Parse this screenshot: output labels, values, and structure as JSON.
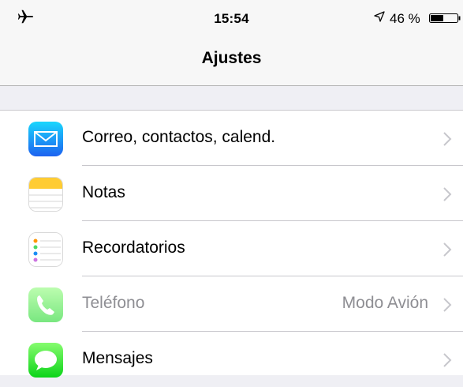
{
  "status_bar": {
    "time": "15:54",
    "battery_percent": "46 %",
    "icons": [
      "airplane-icon",
      "location-arrow-icon",
      "battery-icon"
    ]
  },
  "nav": {
    "title": "Ajustes"
  },
  "settings": {
    "rows": [
      {
        "label": "Correo, contactos, calend.",
        "detail": "",
        "icon": "mail-icon",
        "enabled": true
      },
      {
        "label": "Notas",
        "detail": "",
        "icon": "notes-icon",
        "enabled": true
      },
      {
        "label": "Recordatorios",
        "detail": "",
        "icon": "reminders-icon",
        "enabled": true
      },
      {
        "label": "Teléfono",
        "detail": "Modo Avión",
        "icon": "phone-icon",
        "enabled": false
      },
      {
        "label": "Mensajes",
        "detail": "",
        "icon": "messages-icon",
        "enabled": true
      }
    ]
  },
  "colors": {
    "mail": "#1a8ef5",
    "notes": "#ffcc33",
    "phone": "#4cd964",
    "messages": "#4cd964",
    "disabled_text": "#8e8e93"
  }
}
